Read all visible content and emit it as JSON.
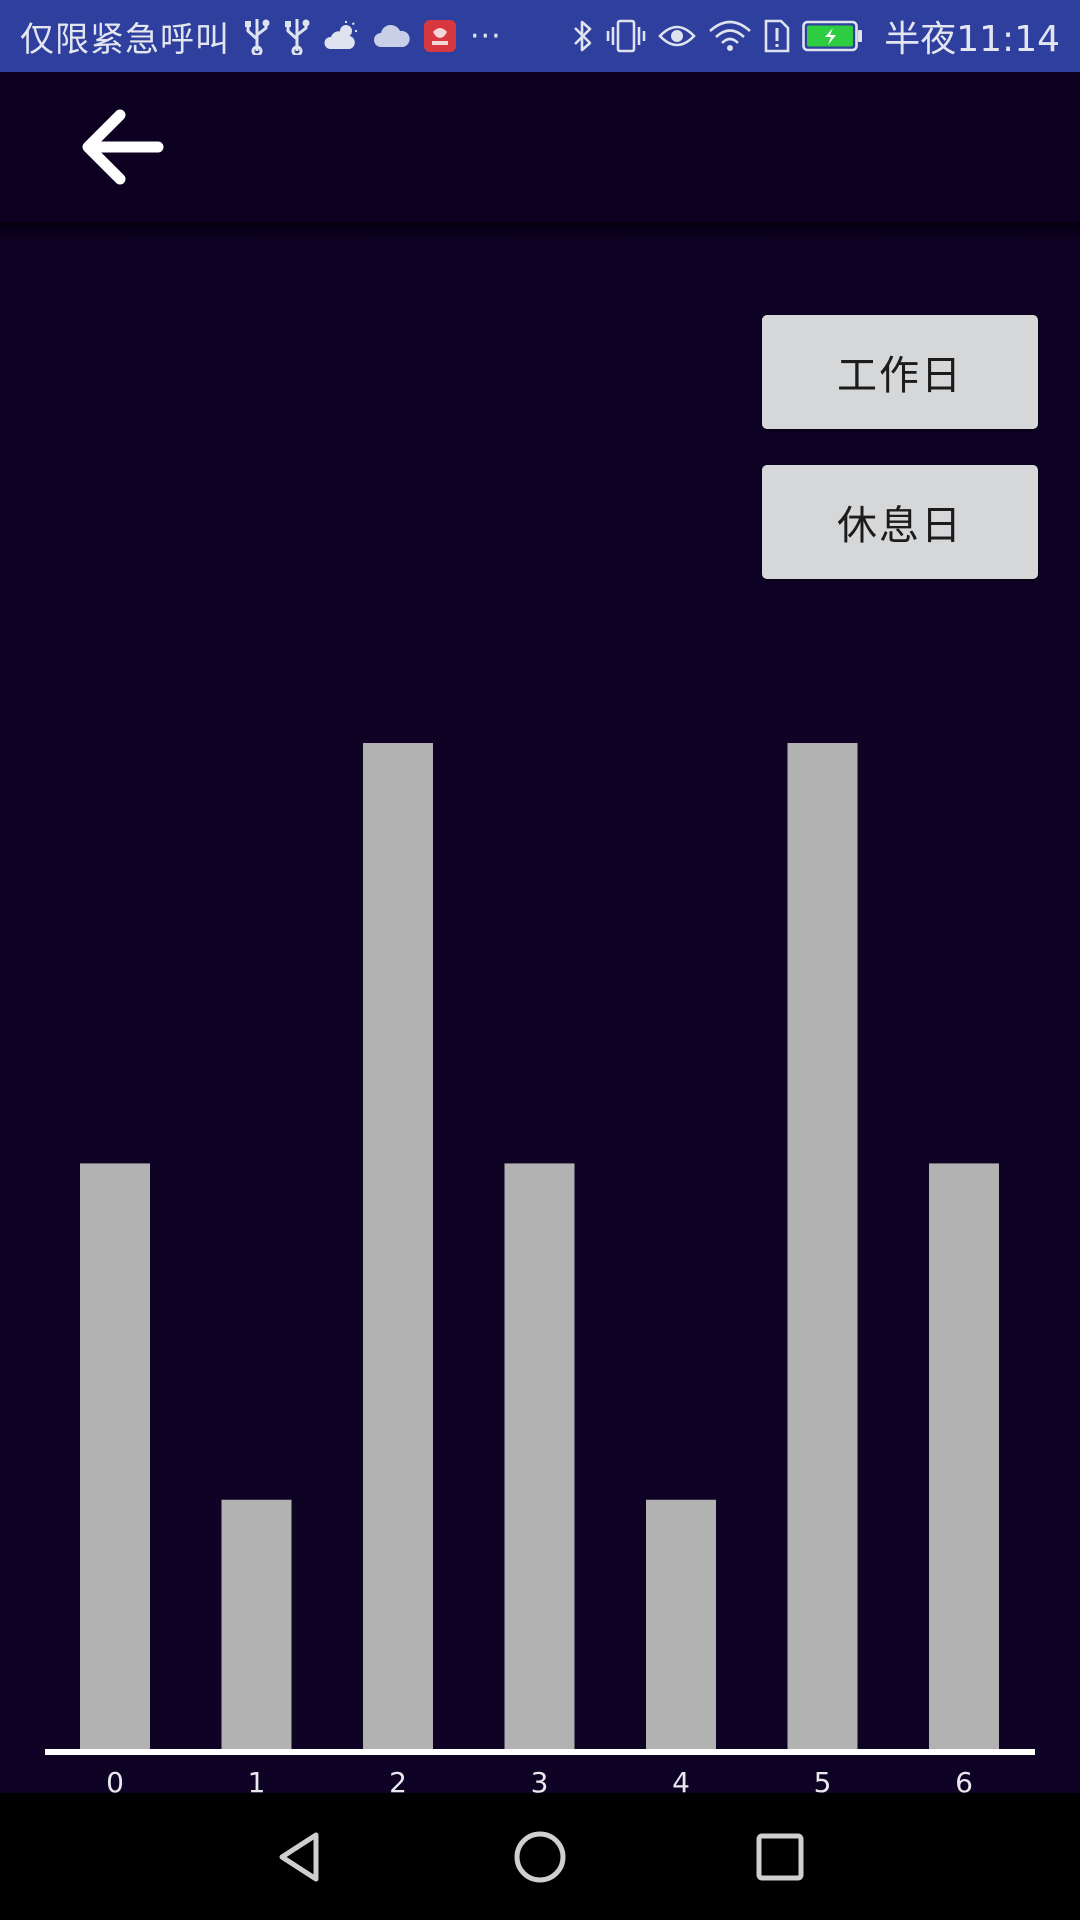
{
  "status_bar": {
    "carrier_text": "仅限紧急呼叫",
    "overflow_dots": "···",
    "time": "半夜11:14",
    "battery_level": 1.0,
    "left_icons": [
      "usb-icon",
      "usb-icon",
      "weather-cloud-sun-icon",
      "cloud-icon",
      "jd-app-icon"
    ],
    "right_icons": [
      "bluetooth-icon",
      "vibrate-icon",
      "eye-comfort-icon",
      "wifi-icon",
      "sim-alert-icon",
      "battery-charging-icon"
    ]
  },
  "toolbar": {
    "back_icon": "arrow-back-icon"
  },
  "buttons": {
    "workday_label": "工作日",
    "restday_label": "休息日"
  },
  "chart_data": {
    "type": "bar",
    "categories": [
      "0",
      "1",
      "2",
      "3",
      "4",
      "5",
      "6"
    ],
    "values": [
      7,
      3,
      12,
      7,
      3,
      12,
      7
    ],
    "ylim": [
      0,
      12
    ],
    "grid": false,
    "legend": "none",
    "bar_color": "#b2b2b2",
    "axis_color": "#ffffff",
    "background_color": "#0e0225"
  },
  "nav_bar": {
    "icons": [
      "nav-back-icon",
      "nav-home-icon",
      "nav-recents-icon"
    ]
  },
  "colors": {
    "status_bar": "#2e3f9e",
    "app_bar": "#0c0120",
    "background": "#0e0225",
    "button_bg": "#d6d7d8",
    "button_text": "#1c1c1c"
  }
}
